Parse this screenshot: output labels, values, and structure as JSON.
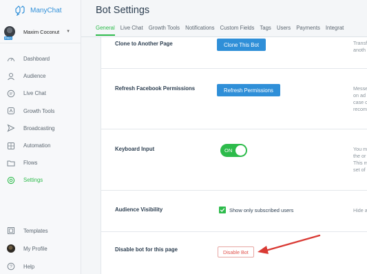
{
  "brand": {
    "name": "ManyChat"
  },
  "account": {
    "name": "Maxim Coconut",
    "badge": "PRO"
  },
  "sidebar": {
    "items": [
      {
        "label": "Dashboard",
        "icon": "dashboard-icon"
      },
      {
        "label": "Audience",
        "icon": "user-icon"
      },
      {
        "label": "Live Chat",
        "icon": "chat-icon"
      },
      {
        "label": "Growth Tools",
        "icon": "growth-icon"
      },
      {
        "label": "Broadcasting",
        "icon": "send-icon"
      },
      {
        "label": "Automation",
        "icon": "automation-icon"
      },
      {
        "label": "Flows",
        "icon": "folder-icon"
      },
      {
        "label": "Settings",
        "icon": "gear-icon",
        "active": true
      }
    ],
    "bottom": [
      {
        "label": "Templates",
        "icon": "templates-icon"
      },
      {
        "label": "My Profile",
        "icon": "avatar"
      },
      {
        "label": "Help",
        "icon": "help-icon"
      }
    ]
  },
  "page": {
    "title": "Bot Settings"
  },
  "tabs": [
    "General",
    "Live Chat",
    "Growth Tools",
    "Notifications",
    "Custom Fields",
    "Tags",
    "Users",
    "Payments",
    "Integrat"
  ],
  "rows": {
    "clone": {
      "title": "Clone to Another Page",
      "button": "Clone This Bot",
      "desc": [
        "Transf",
        "anoth"
      ]
    },
    "refresh": {
      "title": "Refresh Facebook Permissions",
      "button": "Refresh Permissions",
      "desc": [
        "Messe",
        "on ad",
        "case o",
        "recom"
      ]
    },
    "keyboard": {
      "title": "Keyboard Input",
      "toggle": "ON",
      "desc": [
        "You m",
        "the or",
        "This m",
        "set of"
      ]
    },
    "audience": {
      "title": "Audience Visibility",
      "checkbox": "Show only subscribed users",
      "desc": [
        "Hide a"
      ]
    },
    "disable": {
      "title": "Disable bot for this page",
      "button": "Disable Bot"
    }
  },
  "colors": {
    "accent": "#2dbb4b",
    "primary": "#2f8fd8",
    "danger": "#e0514b",
    "arrow": "#d93a34"
  }
}
